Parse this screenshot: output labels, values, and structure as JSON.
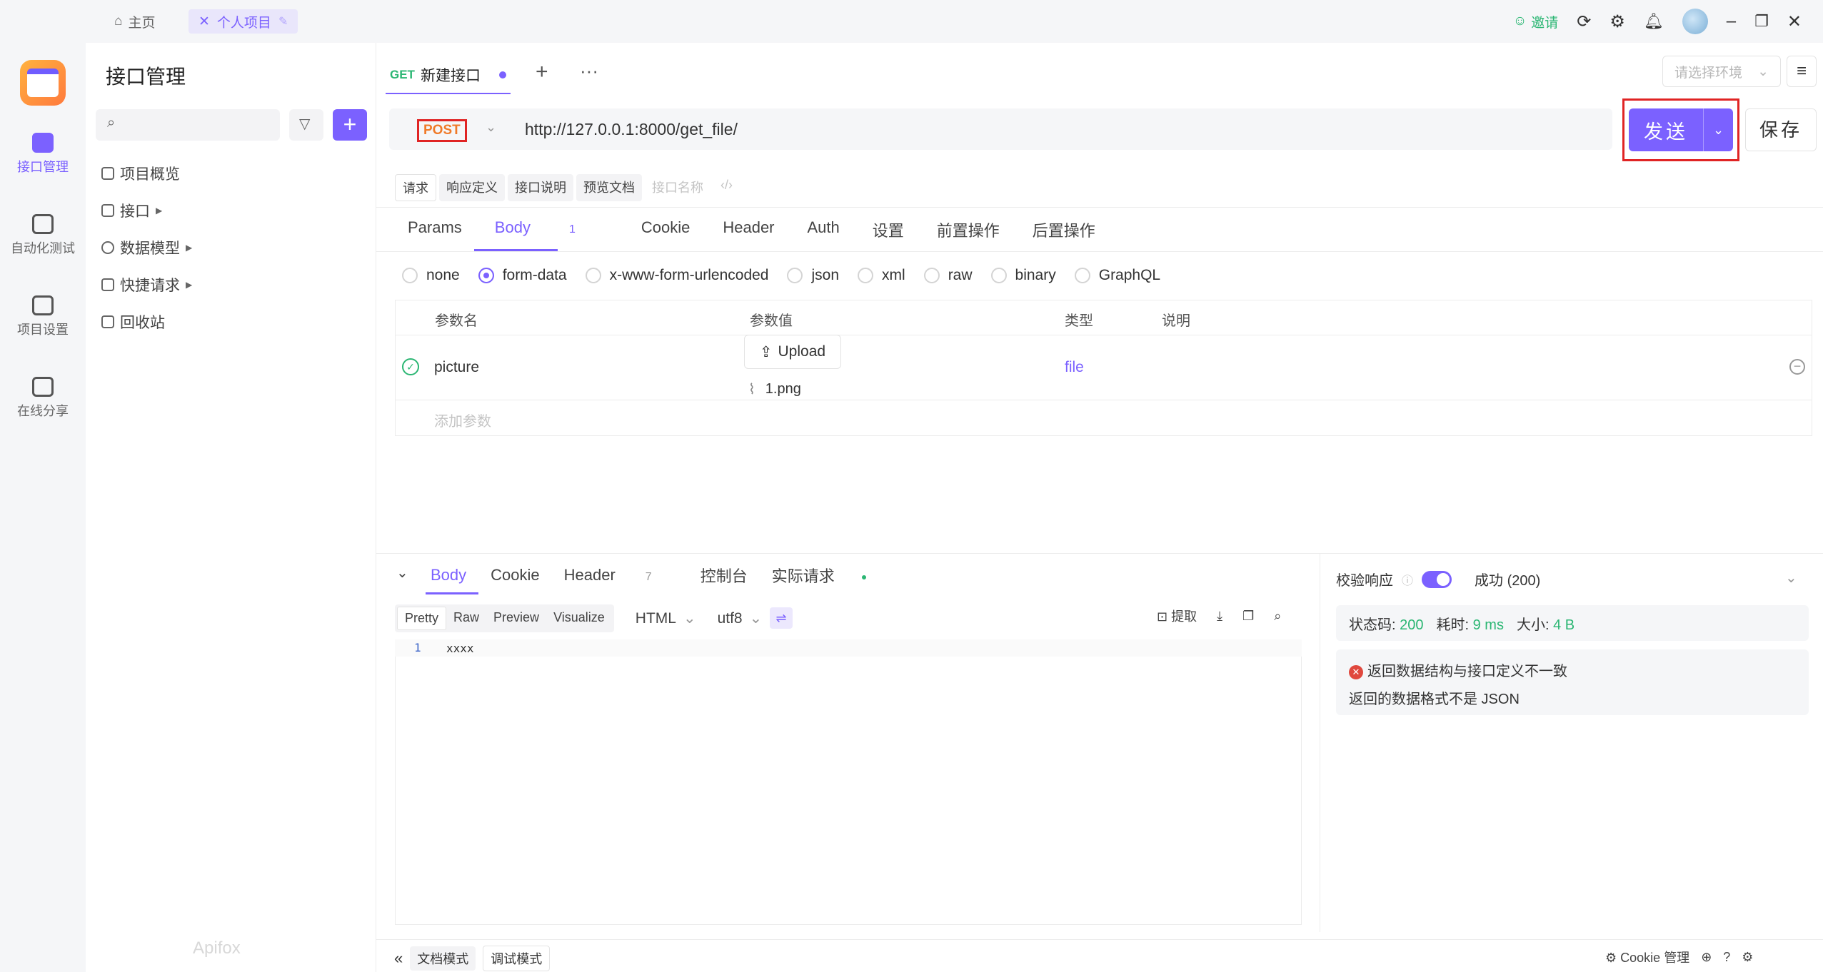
{
  "topbar": {
    "home_tab": "主页",
    "project_tab": "个人项目",
    "invite": "邀请"
  },
  "rail": {
    "items": [
      {
        "label": "接口管理"
      },
      {
        "label": "自动化测试"
      },
      {
        "label": "项目设置"
      },
      {
        "label": "在线分享"
      }
    ]
  },
  "sidebar": {
    "title": "接口管理",
    "items": [
      {
        "label": "项目概览"
      },
      {
        "label": "接口"
      },
      {
        "label": "数据模型"
      },
      {
        "label": "快捷请求"
      },
      {
        "label": "回收站"
      }
    ],
    "watermark": "Apifox"
  },
  "editor_tab": {
    "method": "GET",
    "name": "新建接口"
  },
  "env_select": {
    "placeholder": "请选择环境"
  },
  "request": {
    "method": "POST",
    "url": "http://127.0.0.1:8000/get_file/",
    "send_label": "发送",
    "save_label": "保存"
  },
  "subtabs": {
    "items": [
      "请求",
      "响应定义",
      "接口说明",
      "预览文档"
    ],
    "name_placeholder": "接口名称"
  },
  "param_tabs": {
    "items": [
      "Params",
      "Body",
      "Cookie",
      "Header",
      "Auth",
      "设置",
      "前置操作",
      "后置操作"
    ],
    "body_count": "1"
  },
  "body_types": [
    "none",
    "form-data",
    "x-www-form-urlencoded",
    "json",
    "xml",
    "raw",
    "binary",
    "GraphQL"
  ],
  "params_table": {
    "headers": [
      "参数名",
      "参数值",
      "类型",
      "说明"
    ],
    "row": {
      "name": "picture",
      "upload_label": "Upload",
      "file_name": "1.png",
      "type": "file"
    },
    "add_placeholder": "添加参数"
  },
  "response": {
    "tabs": [
      "Body",
      "Cookie",
      "Header",
      "控制台",
      "实际请求"
    ],
    "header_count": "7",
    "view_modes": [
      "Pretty",
      "Raw",
      "Preview",
      "Visualize"
    ],
    "format": "HTML",
    "encoding": "utf8",
    "extract_label": "提取",
    "code_line_number": "1",
    "code_text": "xxxx"
  },
  "validation": {
    "label": "校验响应",
    "result": "成功 (200)",
    "status_label": "状态码:",
    "status_value": "200",
    "time_label": "耗时:",
    "time_value": "9 ms",
    "size_label": "大小:",
    "size_value": "4 B",
    "error_title": "返回数据结构与接口定义不一致",
    "error_detail": "返回的数据格式不是 JSON"
  },
  "bottom": {
    "doc_mode": "文档模式",
    "debug_mode": "调试模式",
    "cookie_manage": "Cookie 管理"
  },
  "colors": {
    "accent": "#7b61ff",
    "success": "#2bb673",
    "highlight_frame": "#e02424"
  }
}
